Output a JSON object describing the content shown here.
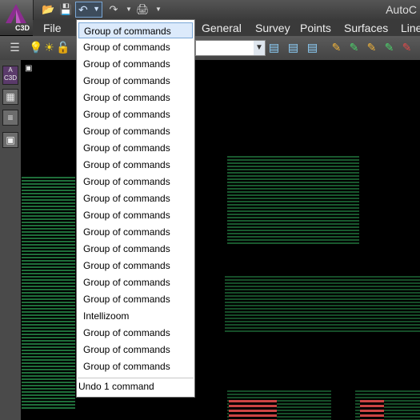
{
  "app": {
    "title": "AutoC",
    "badge": "C3D"
  },
  "menu": {
    "items": [
      "File",
      "General",
      "Survey",
      "Points",
      "Surfaces",
      "Line"
    ]
  },
  "dropdown": {
    "items": [
      "Group of commands",
      "Group of commands",
      "Group of commands",
      "Group of commands",
      "Group of commands",
      "Group of commands",
      "Group of commands",
      "Group of commands",
      "Group of commands",
      "Group of commands",
      "Group of commands",
      "Group of commands",
      "Group of commands",
      "Group of commands",
      "Group of commands",
      "Group of commands",
      "Group of commands",
      "Intellizoom",
      "Group of commands",
      "Group of commands",
      "Group of commands"
    ],
    "footer": "Undo 1 command"
  },
  "left_toolbar": {
    "top_badge": "C3D"
  },
  "colors": {
    "selection": "#dceafb",
    "drawing": "#1bb27a"
  }
}
